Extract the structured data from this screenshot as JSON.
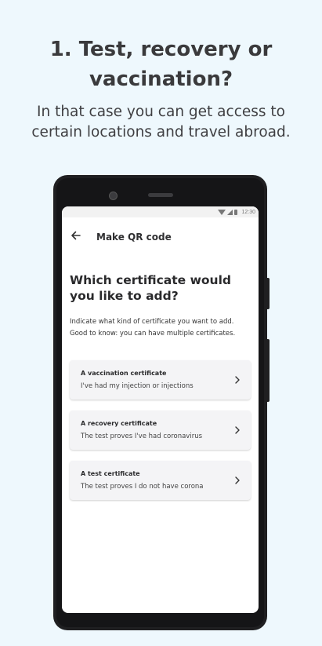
{
  "headline": {
    "line1": "1.  Test, recovery or",
    "line2": "vaccination?"
  },
  "subtitle": {
    "line1": "In that case you can get access to",
    "line2": "certain locations and travel abroad."
  },
  "phone": {
    "status_bar": {
      "time": "12:30",
      "icons": [
        "wifi-icon",
        "signal-icon",
        "battery-icon"
      ]
    },
    "app_bar": {
      "back_icon": "arrow-left-icon",
      "title": "Make QR code"
    },
    "question": {
      "line1": "Which certificate would",
      "line2": "you like to add?"
    },
    "description": {
      "line1": "Indicate what kind of certificate you want to add.",
      "line2": "Good to know: you can have multiple certificates."
    },
    "options": [
      {
        "title": "A vaccination certificate",
        "subtitle": "I've had my injection or injections",
        "icon": "chevron-right-icon"
      },
      {
        "title": "A recovery certificate",
        "subtitle": "The test proves I've had coronavirus",
        "icon": "chevron-right-icon"
      },
      {
        "title": "A test certificate",
        "subtitle": "The test proves I do not have corona",
        "icon": "chevron-right-icon"
      }
    ]
  },
  "colors": {
    "page_background": "#eef8fd",
    "phone_frame": "#1f1f21",
    "card_background": "#f4f4f6",
    "text_dark": "#2a2a2c"
  }
}
